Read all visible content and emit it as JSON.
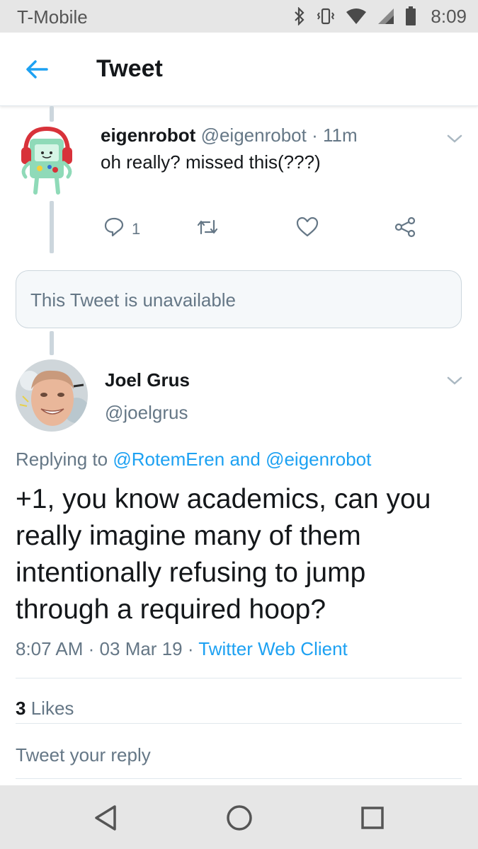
{
  "status_bar": {
    "carrier": "T-Mobile",
    "time": "8:09",
    "icons": [
      "bluetooth-icon",
      "vibrate-icon",
      "wifi-icon",
      "signal-icon",
      "battery-icon"
    ]
  },
  "header": {
    "title": "Tweet",
    "back_icon": "back-arrow-icon"
  },
  "reply_tweet": {
    "name": "eigenrobot",
    "handle": "@eigenrobot",
    "separator": "·",
    "time": "11m",
    "text": "oh really? missed this(???)",
    "reply_count": "1",
    "icons": [
      "reply-icon",
      "retweet-icon",
      "like-icon",
      "share-icon"
    ]
  },
  "unavailable": {
    "text": "This Tweet is unavailable"
  },
  "main_tweet": {
    "name": "Joel Grus",
    "handle": "@joelgrus",
    "replying_prefix": "Replying to",
    "replying_user1": "@RotemEren",
    "replying_and": "and",
    "replying_user2": "@eigenrobot",
    "text": "+1, you know academics, can you really imagine many of them intentionally refusing to jump through a required hoop?",
    "time": "8:07 AM",
    "dot1": "·",
    "date": "03 Mar 19",
    "dot2": "·",
    "client": "Twitter Web Client",
    "likes_count": "3",
    "likes_label": "Likes"
  },
  "reply_input": {
    "placeholder": "Tweet your reply"
  },
  "colors": {
    "accent": "#1da1f2",
    "muted": "#657786",
    "text": "#14171a",
    "bars": "#e6e6e6"
  }
}
